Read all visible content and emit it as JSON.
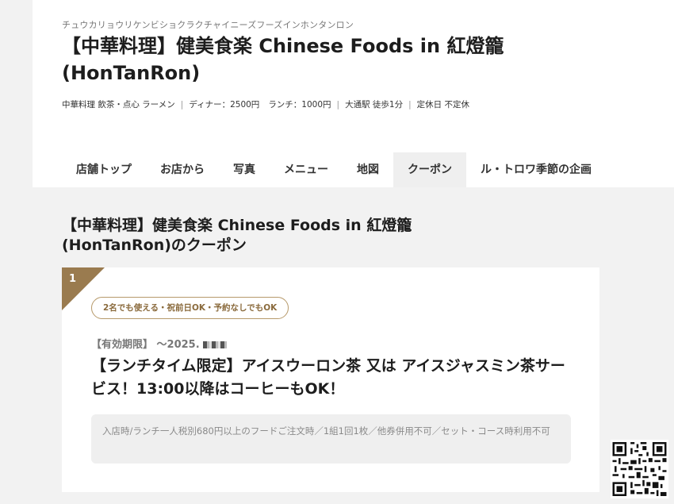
{
  "header": {
    "kana": "チュウカリョウリケンビショクラクチャイニーズフーズインホンタンロン",
    "title": "【中華料理】健美食楽 Chinese Foods in 紅燈籠 (HonTanRon)",
    "meta": {
      "genre": "中華料理 飲茶・点心 ラーメン",
      "dinner": "ディナー：2500円",
      "lunch": "ランチ：1000円",
      "access": "大通駅 徒歩1分",
      "holiday": "定休日 不定休",
      "separator": "|"
    }
  },
  "tabs": [
    {
      "label": "店舗トップ",
      "active": false
    },
    {
      "label": "お店から",
      "active": false
    },
    {
      "label": "写真",
      "active": false
    },
    {
      "label": "メニュー",
      "active": false
    },
    {
      "label": "地図",
      "active": false
    },
    {
      "label": "クーポン",
      "active": true
    },
    {
      "label": "ル・トロワ季節の企画",
      "active": false
    }
  ],
  "section": {
    "title": "【中華料理】健美食楽 Chinese Foods in 紅燈籠 (HonTanRon)のクーポン"
  },
  "coupon": {
    "number": "1",
    "badge": "2名でも使える・祝前日OK・予約なしでもOK",
    "validity_label": "【有効期限】",
    "validity_value": "～2025.",
    "headline": "【ランチタイム限定】アイスウーロン茶 又は アイスジャスミン茶サービス！13:00以降はコーヒーもOK！",
    "conditions": "入店時/ランチ一人税別680円以上のフードご注文時／1組1回1枚／他券併用不可／セット・コース時利用不可"
  },
  "colors": {
    "accent": "#9a7b4f",
    "badge_border": "#b79a6b",
    "background": "#f2f2f2"
  }
}
